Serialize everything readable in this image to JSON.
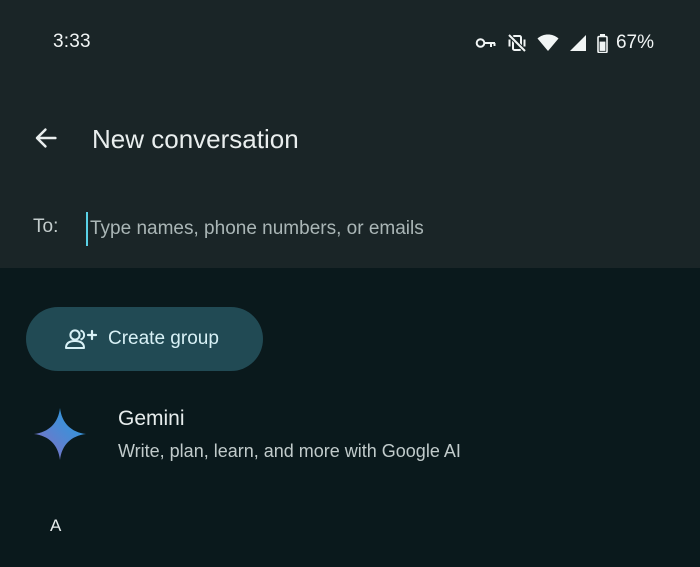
{
  "status_bar": {
    "time": "3:33",
    "battery_percent": "67%",
    "icons": [
      "vpn-key-icon",
      "vibrate-off-icon",
      "wifi-icon",
      "cell-signal-icon",
      "battery-icon"
    ]
  },
  "app_bar": {
    "back_icon": "arrow-back-icon",
    "title": "New conversation"
  },
  "recipient": {
    "label": "To:",
    "placeholder": "Type names, phone numbers, or emails",
    "value": ""
  },
  "create_group": {
    "icon": "group-add-icon",
    "label": "Create group"
  },
  "contacts": {
    "featured": {
      "icon": "gemini-sparkle-icon",
      "name": "Gemini",
      "description": "Write, plan, learn, and more with Google AI"
    },
    "section_header": "A"
  },
  "colors": {
    "background": "#0a191c",
    "top_panel": "#1a2527",
    "create_group_bg": "#214a54",
    "cursor_accent": "#5ad1e6"
  }
}
